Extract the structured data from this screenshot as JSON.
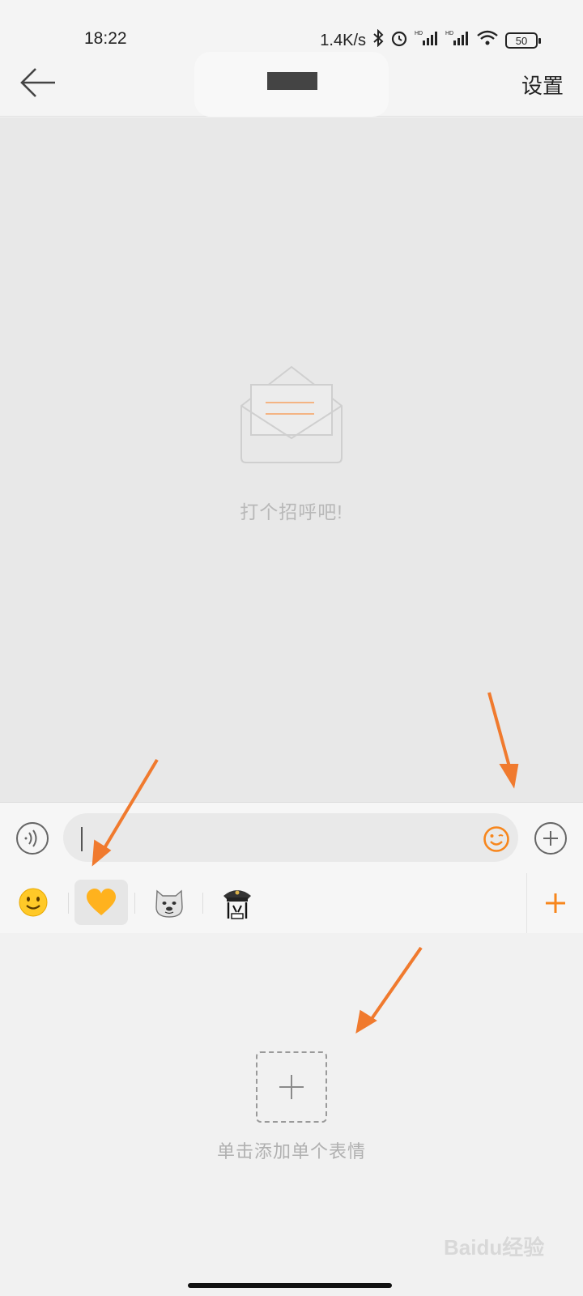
{
  "status_bar": {
    "time": "18:22",
    "network_speed": "1.4K/s",
    "battery": "50"
  },
  "header": {
    "title": "",
    "settings_label": "设置"
  },
  "chat": {
    "empty_hint": "打个招呼吧!"
  },
  "input": {
    "value": "",
    "placeholder": ""
  },
  "sticker_tabs": [
    {
      "name": "emoji-smile-icon"
    },
    {
      "name": "heart-sticker-icon",
      "selected": true
    },
    {
      "name": "doge-sticker-icon"
    },
    {
      "name": "police-hat-sticker-icon"
    }
  ],
  "panel": {
    "add_label": "单击添加单个表情",
    "watermark": "Baidu经验"
  },
  "colors": {
    "accent": "#f7861c",
    "arrow": "#f07a2e",
    "background": "#e8e8e8"
  }
}
